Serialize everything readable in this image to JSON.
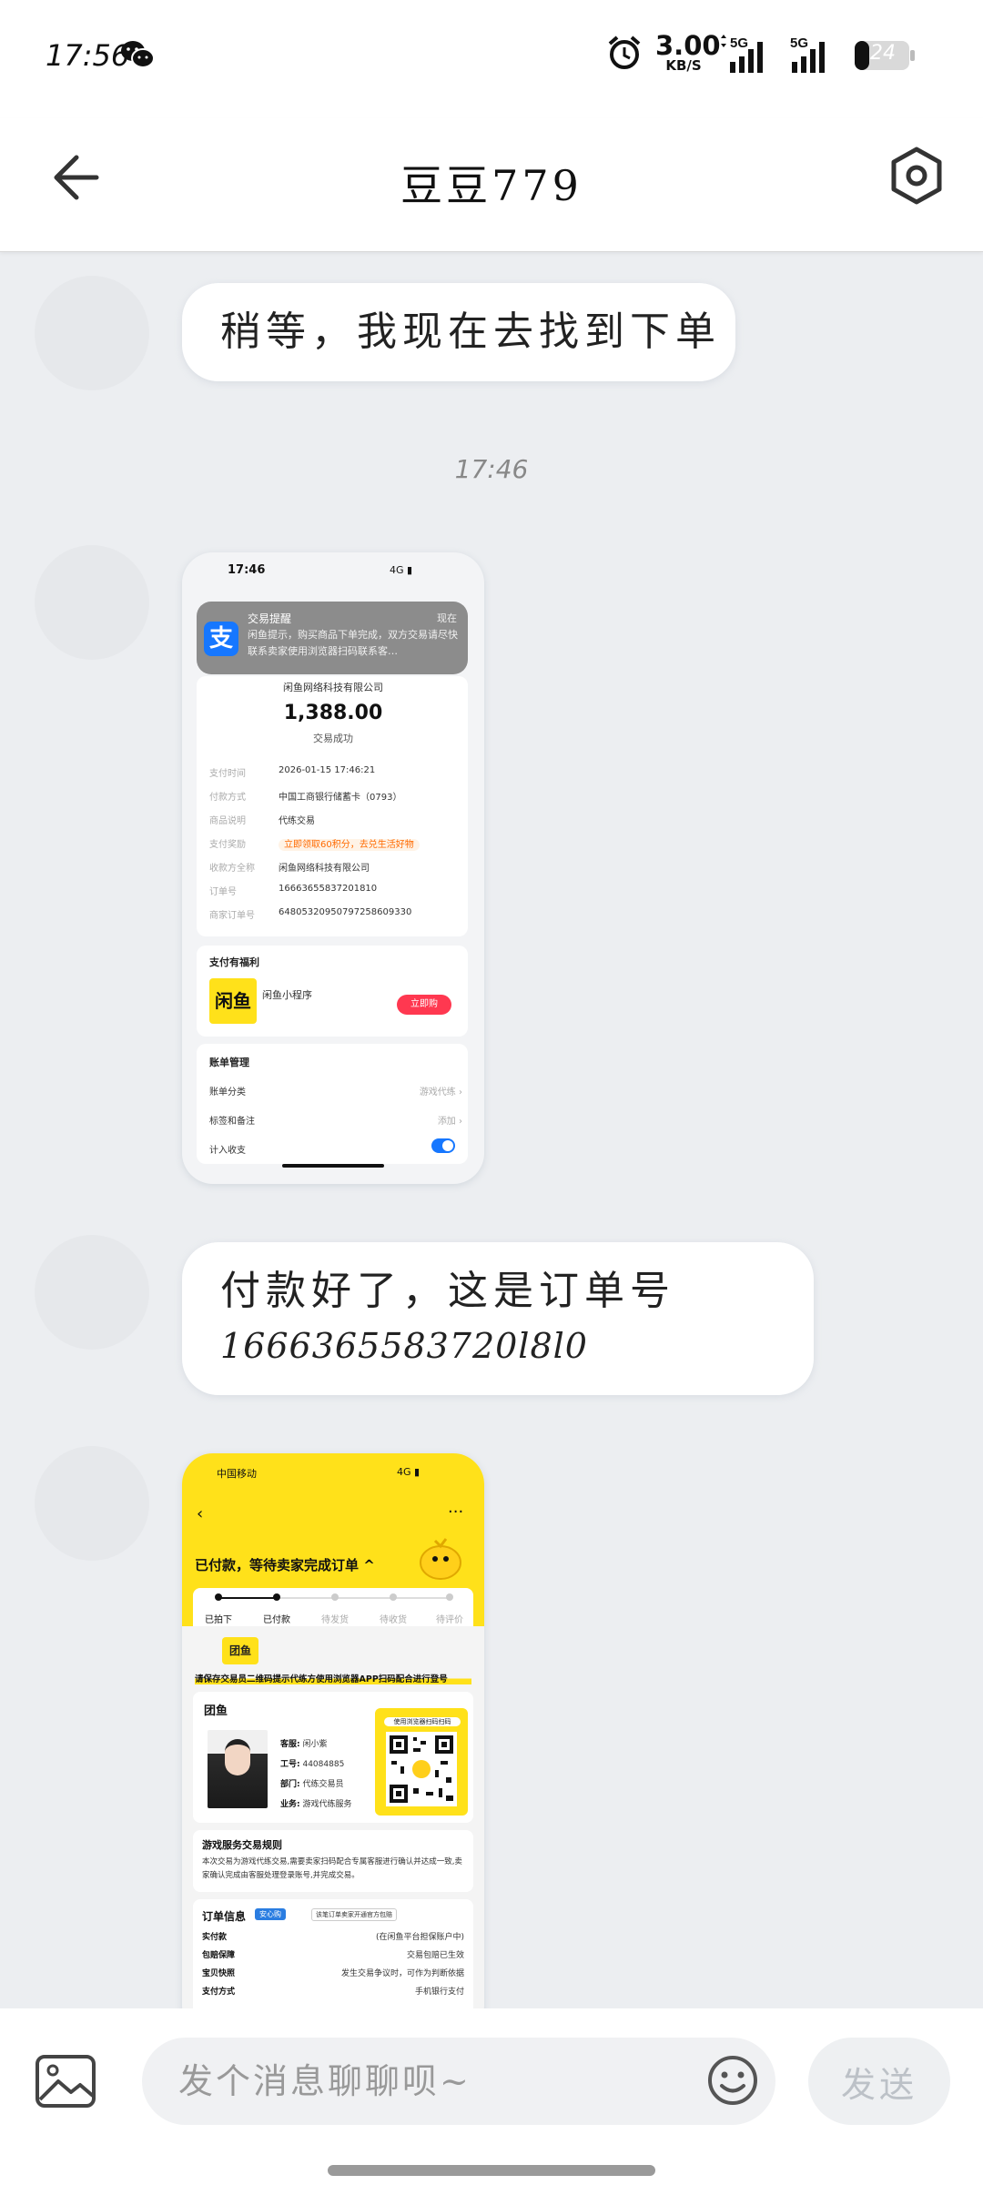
{
  "status_bar": {
    "time": "17:56",
    "net_speed_value": "3.00",
    "net_speed_unit": "KB/S",
    "signal1_label": "5G",
    "signal2_label": "5G",
    "battery": "24"
  },
  "header": {
    "title": "豆豆779"
  },
  "messages": {
    "msg1": "稍等，我现在去找到下单",
    "timestamp": "17:46",
    "msg2_line1": "付款好了，这是订单号",
    "msg2_line2": "1666365583720l8l0"
  },
  "shot1": {
    "time": "17:46",
    "net": "4G",
    "notif_title": "交易提醒",
    "notif_time": "现在",
    "notif_body": "闲鱼提示，购买商品下单完成，双方交易请尽快联系卖家使用浏览器扫码联系客…",
    "merchant": "闲鱼网络科技有限公司",
    "amount": "1,388.00",
    "status": "交易成功",
    "rows": [
      {
        "k": "支付时间",
        "v": "2026-01-15 17:46:21"
      },
      {
        "k": "付款方式",
        "v": "中国工商银行储蓄卡（0793）"
      },
      {
        "k": "商品说明",
        "v": "代练交易"
      },
      {
        "k": "支付奖励",
        "v": "立即领取60积分，去兑生活好物"
      },
      {
        "k": "收款方全称",
        "v": "闲鱼网络科技有限公司"
      },
      {
        "k": "订单号",
        "v": "16663655837201810"
      },
      {
        "k": "商家订单号",
        "v": "64805320950797258609330"
      }
    ],
    "benefit_title": "支付有福利",
    "xianyu_logo": "闲鱼",
    "mini_program": "闲鱼小程序",
    "buy_now": "立即购",
    "bill_title": "账单管理",
    "bill_category": "账单分类",
    "bill_category_value": "游戏代练",
    "tags": "标签和备注",
    "tags_value": "添加",
    "include": "计入收支"
  },
  "shot2": {
    "carrier": "中国移动",
    "net": "4G",
    "headline": "已付款，等待卖家完成订单",
    "steps": [
      "已拍下",
      "已付款",
      "待发货",
      "待收货",
      "待评价"
    ],
    "tuanyu": "团鱼",
    "banner": "请保存交易员二维码提示代练方使用浏览器APP扫码配合进行登号",
    "card_logo": "团鱼",
    "staff": [
      {
        "k": "客服:",
        "v": "闲小紫"
      },
      {
        "k": "工号:",
        "v": "44084885"
      },
      {
        "k": "部门:",
        "v": "代练交易员"
      },
      {
        "k": "业务:",
        "v": "游戏代练服务"
      }
    ],
    "qr_label": "使用浏览器扫码扫码",
    "rules_title": "游戏服务交易规则",
    "rules_text": "本次交易为游戏代练交易,需要卖家扫码配合专属客服进行确认并达成一致,卖家确认完成由客服处理登录账号,并完成交易。",
    "order_title": "订单信息",
    "order_badge": "安心购",
    "order_note": "该笔订单卖家开通官方包赔",
    "order_rows": [
      {
        "k": "实付款",
        "v": "(在闲鱼平台担保账户中)"
      },
      {
        "k": "包赔保障",
        "v": "交易包赔已生效"
      },
      {
        "k": "宝贝快照",
        "v": "发生交易争议时，可作为判断依据"
      },
      {
        "k": "支付方式",
        "v": "手机银行支付"
      }
    ]
  },
  "input": {
    "placeholder": "发个消息聊聊呗~",
    "send_label": "发送"
  }
}
